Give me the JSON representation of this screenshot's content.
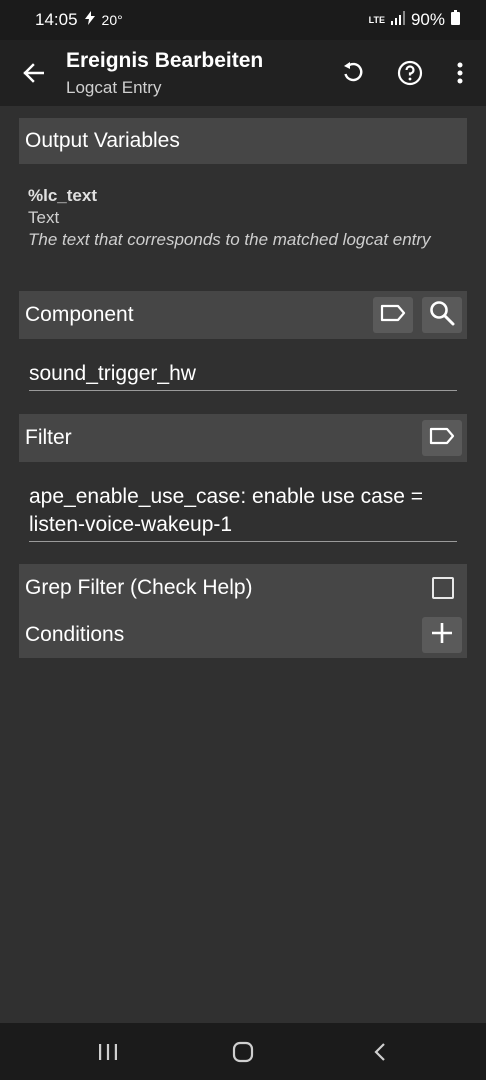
{
  "status_bar": {
    "time": "14:05",
    "temperature": "20°",
    "network": "LTE",
    "battery": "90%"
  },
  "app_bar": {
    "title": "Ereignis Bearbeiten",
    "subtitle": "Logcat Entry",
    "icons": [
      "back-arrow-icon",
      "undo-icon",
      "help-icon",
      "more-vert-icon"
    ]
  },
  "output_variables": {
    "header": "Output Variables",
    "name": "%lc_text",
    "type": "Text",
    "description": "The text that corresponds to the matched logcat entry"
  },
  "component": {
    "label": "Component",
    "value": "sound_trigger_hw"
  },
  "filter": {
    "label": "Filter",
    "value_line1": "ape_enable_use_case: enable use case =",
    "value_line2": "listen-voice-wakeup-1"
  },
  "grep_filter": {
    "label": "Grep Filter (Check Help)",
    "checked": false
  },
  "conditions": {
    "label": "Conditions"
  },
  "colors": {
    "background": "#303030",
    "section_header": "#464646",
    "bars": "#1b1b1b"
  }
}
